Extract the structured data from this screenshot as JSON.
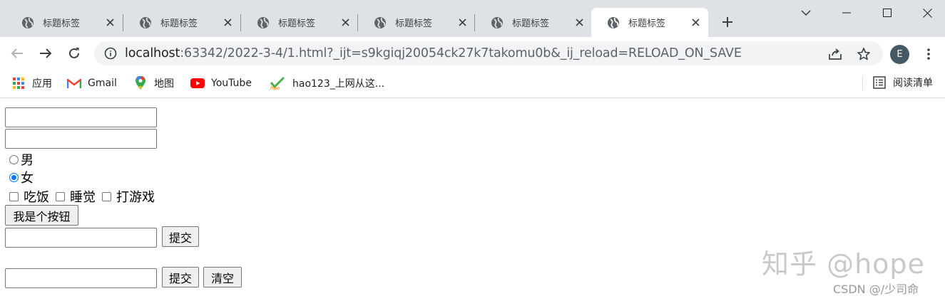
{
  "browser": {
    "tabs": [
      {
        "title": "标题标签",
        "active": false
      },
      {
        "title": "标题标签",
        "active": false
      },
      {
        "title": "标题标签",
        "active": false
      },
      {
        "title": "标题标签",
        "active": false
      },
      {
        "title": "标题标签",
        "active": false
      },
      {
        "title": "标题标签",
        "active": true
      }
    ],
    "url_host": "localhost",
    "url_rest": ":63342/2022-3-4/1.html?_ijt=s9kgiqj20054ck27k7takomu0b&_ij_reload=RELOAD_ON_SAVE",
    "profile_initial": "E"
  },
  "bookmarks": {
    "items": [
      {
        "label": "应用",
        "icon": "apps-grid-icon"
      },
      {
        "label": "Gmail",
        "icon": "gmail-icon"
      },
      {
        "label": "地图",
        "icon": "maps-pin-icon"
      },
      {
        "label": "YouTube",
        "icon": "youtube-icon"
      },
      {
        "label": "hao123_上网从这...",
        "icon": "hao123-icon"
      }
    ],
    "reading_list": "阅读清单"
  },
  "form": {
    "text1_value": "",
    "text2_value": "",
    "gender": [
      {
        "label": "男",
        "checked": false
      },
      {
        "label": "女",
        "checked": true
      }
    ],
    "hobbies": [
      {
        "label": "吃饭",
        "checked": false
      },
      {
        "label": "睡觉",
        "checked": false
      },
      {
        "label": "打游戏",
        "checked": false
      }
    ],
    "button_label": "我是个按钮",
    "submit1_label": "提交",
    "submit2_label": "提交",
    "reset_label": "清空"
  },
  "watermark": {
    "main": "知乎 @hope",
    "sub": "CSDN @/少司命"
  },
  "colors": {
    "tabstrip": "#dee1e6",
    "radio_checked": "#0075ff",
    "avatar": "#455a64"
  }
}
